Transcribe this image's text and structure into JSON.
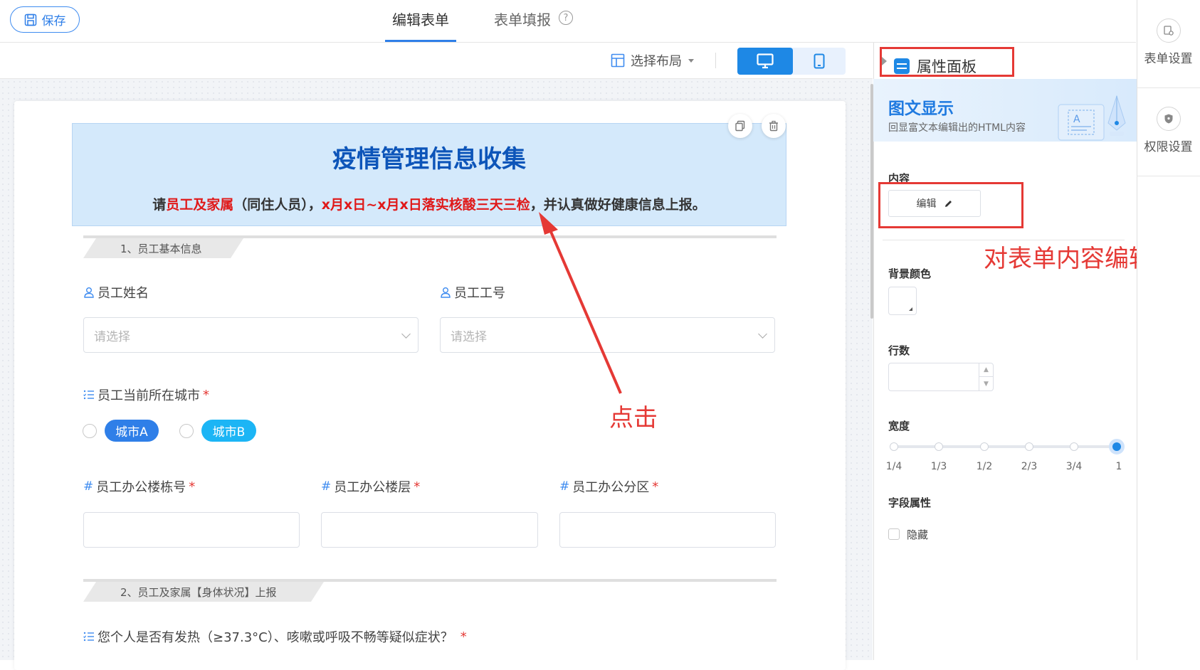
{
  "header": {
    "save_label": "保存",
    "tabs": [
      {
        "label": "编辑表单",
        "active": true
      },
      {
        "label": "表单填报",
        "active": false
      }
    ],
    "help_icon": "?"
  },
  "toolbar": {
    "layout_select_label": "选择布局",
    "devices": [
      {
        "name": "desktop",
        "active": true
      },
      {
        "name": "tablet",
        "active": false
      }
    ]
  },
  "form": {
    "banner": {
      "title": "疫情管理信息收集",
      "subtitle_parts": [
        {
          "text": "请",
          "red": false
        },
        {
          "text": "员工及家属",
          "red": true
        },
        {
          "text": "（同住人员），",
          "red": false
        },
        {
          "text": "x月x日~x月x日落实核酸三天三检",
          "red": true
        },
        {
          "text": "，并认真做好健康信息上报。",
          "red": false
        }
      ]
    },
    "section1": "1、员工基本信息",
    "fields": {
      "name_label": "员工姓名",
      "name_placeholder": "请选择",
      "id_label": "员工工号",
      "id_placeholder": "请选择",
      "city_label": "员工当前所在城市",
      "city_options": [
        "城市A",
        "城市B"
      ],
      "building_label": "员工办公楼栋号",
      "floor_label": "员工办公楼层",
      "area_label": "员工办公分区",
      "required_mark": "*",
      "hash_mark": "#"
    },
    "section2": "2、员工及家属【身体状况】上报",
    "question_label": "您个人是否有发热（≥37.3°C）、咳嗽或呼吸不畅等疑似症状？"
  },
  "annotations": {
    "click": "点击",
    "edit": "对表单内容编辑",
    "color": "#e53935"
  },
  "panel": {
    "title": "属性面板",
    "component_title": "图文显示",
    "component_desc": "回显富文本编辑出的HTML内容",
    "content_label": "内容",
    "edit_button": "编辑",
    "bg_color_label": "背景颜色",
    "rows_label": "行数",
    "width_label": "宽度",
    "width_options": [
      "1/4",
      "1/3",
      "1/2",
      "2/3",
      "3/4",
      "1"
    ],
    "width_selected": "1",
    "field_attr_label": "字段属性",
    "hidden_label": "隐藏",
    "hidden_checked": false
  },
  "rail": [
    {
      "label": "表单设置",
      "icon": "form-settings-icon"
    },
    {
      "label": "权限设置",
      "icon": "permission-shield-icon"
    }
  ],
  "colors": {
    "accent": "#1e88e5",
    "banner_bg": "#d4e9fb",
    "banner_title": "#0d55b9",
    "pill_a": "#2f7fe8",
    "pill_b": "#1cb5f5"
  }
}
